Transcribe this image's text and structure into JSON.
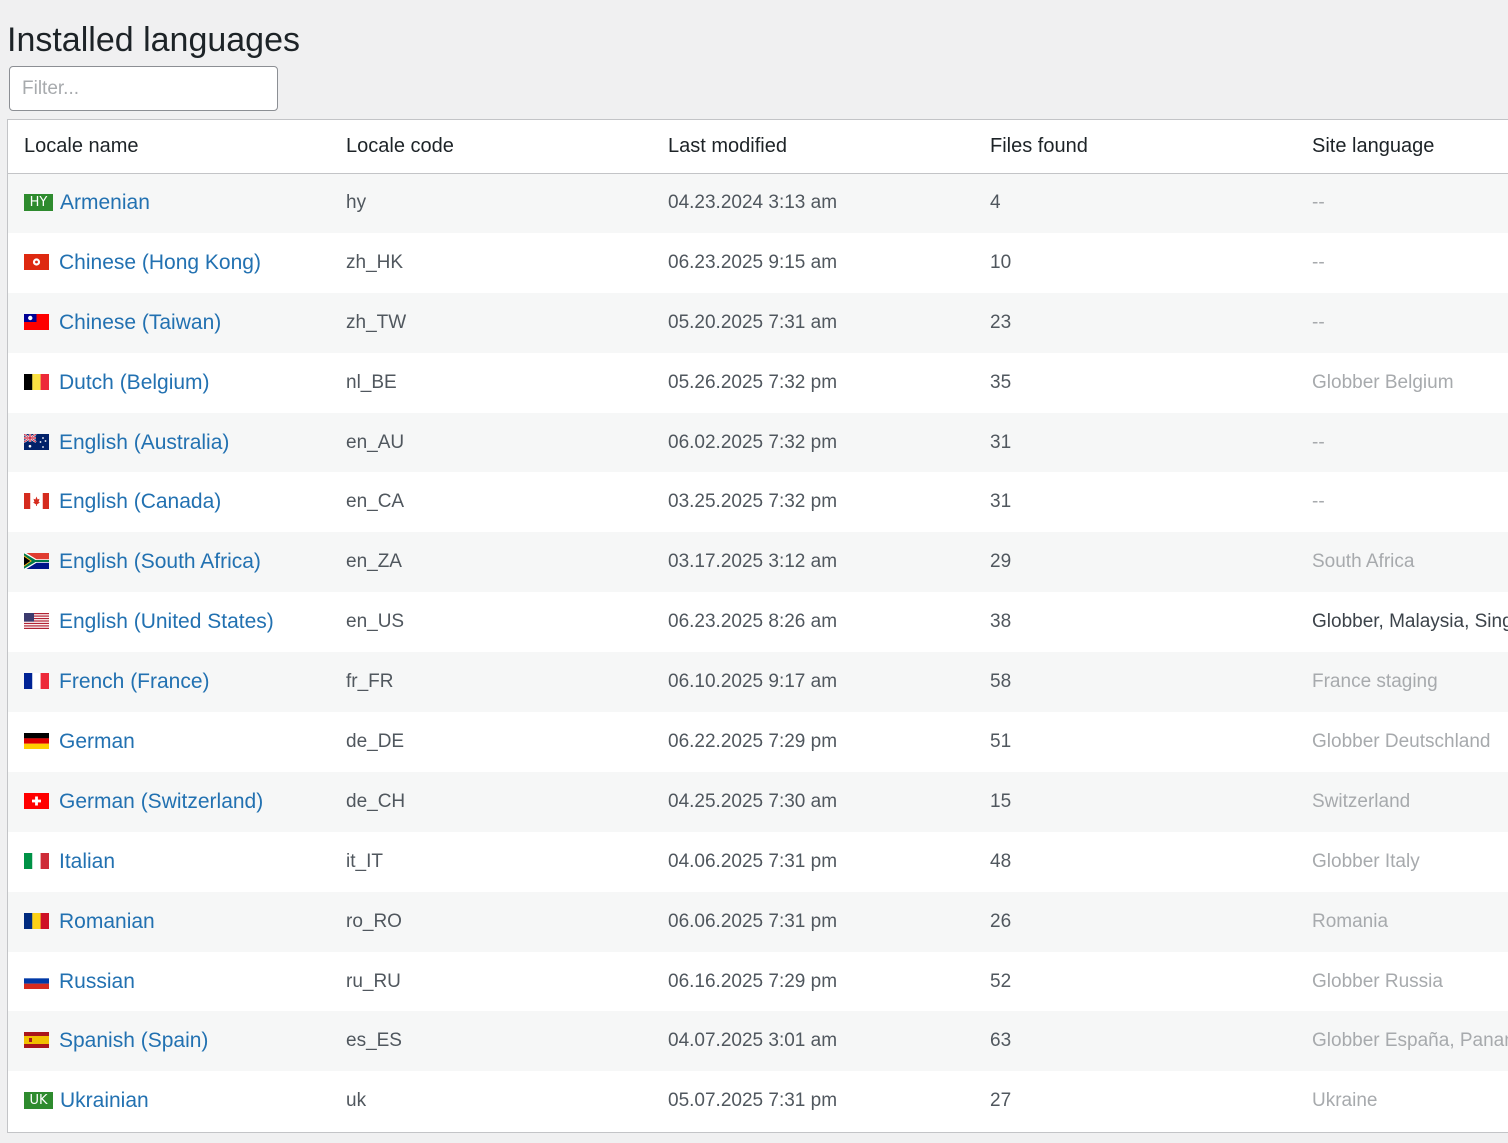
{
  "page": {
    "title": "Installed languages",
    "filter_placeholder": "Filter..."
  },
  "table": {
    "headers": [
      "Locale name",
      "Locale code",
      "Last modified",
      "Files found",
      "Site language"
    ],
    "rows": [
      {
        "flag": "code",
        "flag_text": "HY",
        "name": "Armenian",
        "code": "hy",
        "modified": "04.23.2024 3:13 am",
        "files": "4",
        "site": "--",
        "site_style": "muted"
      },
      {
        "flag": "hk-flag-icon",
        "name": "Chinese (Hong Kong)",
        "code": "zh_HK",
        "modified": "06.23.2025 9:15 am",
        "files": "10",
        "site": "--",
        "site_style": "muted"
      },
      {
        "flag": "tw-flag-icon",
        "name": "Chinese (Taiwan)",
        "code": "zh_TW",
        "modified": "05.20.2025 7:31 am",
        "files": "23",
        "site": "--",
        "site_style": "muted"
      },
      {
        "flag": "be-flag-icon",
        "name": "Dutch (Belgium)",
        "code": "nl_BE",
        "modified": "05.26.2025 7:32 pm",
        "files": "35",
        "site": "Globber Belgium",
        "site_style": "muted"
      },
      {
        "flag": "au-flag-icon",
        "name": "English (Australia)",
        "code": "en_AU",
        "modified": "06.02.2025 7:32 pm",
        "files": "31",
        "site": "--",
        "site_style": "muted"
      },
      {
        "flag": "ca-flag-icon",
        "name": "English (Canada)",
        "code": "en_CA",
        "modified": "03.25.2025 7:32 pm",
        "files": "31",
        "site": "--",
        "site_style": "muted"
      },
      {
        "flag": "za-flag-icon",
        "name": "English (South Africa)",
        "code": "en_ZA",
        "modified": "03.17.2025 3:12 am",
        "files": "29",
        "site": "South Africa",
        "site_style": "muted"
      },
      {
        "flag": "us-flag-icon",
        "name": "English (United States)",
        "code": "en_US",
        "modified": "06.23.2025 8:26 am",
        "files": "38",
        "site": "Globber, Malaysia, Sing",
        "site_style": "strong"
      },
      {
        "flag": "fr-flag-icon",
        "name": "French (France)",
        "code": "fr_FR",
        "modified": "06.10.2025 9:17 am",
        "files": "58",
        "site": "France staging",
        "site_style": "muted"
      },
      {
        "flag": "de-flag-icon",
        "name": "German",
        "code": "de_DE",
        "modified": "06.22.2025 7:29 pm",
        "files": "51",
        "site": "Globber Deutschland",
        "site_style": "muted"
      },
      {
        "flag": "ch-flag-icon",
        "name": "German (Switzerland)",
        "code": "de_CH",
        "modified": "04.25.2025 7:30 am",
        "files": "15",
        "site": "Switzerland",
        "site_style": "muted"
      },
      {
        "flag": "it-flag-icon",
        "name": "Italian",
        "code": "it_IT",
        "modified": "04.06.2025 7:31 pm",
        "files": "48",
        "site": "Globber Italy",
        "site_style": "muted"
      },
      {
        "flag": "ro-flag-icon",
        "name": "Romanian",
        "code": "ro_RO",
        "modified": "06.06.2025 7:31 pm",
        "files": "26",
        "site": "Romania",
        "site_style": "muted"
      },
      {
        "flag": "ru-flag-icon",
        "name": "Russian",
        "code": "ru_RU",
        "modified": "06.16.2025 7:29 pm",
        "files": "52",
        "site": "Globber Russia",
        "site_style": "muted"
      },
      {
        "flag": "es-flag-icon",
        "name": "Spanish (Spain)",
        "code": "es_ES",
        "modified": "04.07.2025 3:01 am",
        "files": "63",
        "site": "Globber España, Panan",
        "site_style": "muted"
      },
      {
        "flag": "code",
        "flag_text": "UK",
        "name": "Ukrainian",
        "code": "uk",
        "modified": "05.07.2025 7:31 pm",
        "files": "27",
        "site": "Ukraine",
        "site_style": "muted"
      }
    ]
  },
  "colors": {
    "link": "#2271b1",
    "muted": "#a7aaad",
    "background": "#f0f0f1",
    "row_alt": "#f6f7f7"
  }
}
